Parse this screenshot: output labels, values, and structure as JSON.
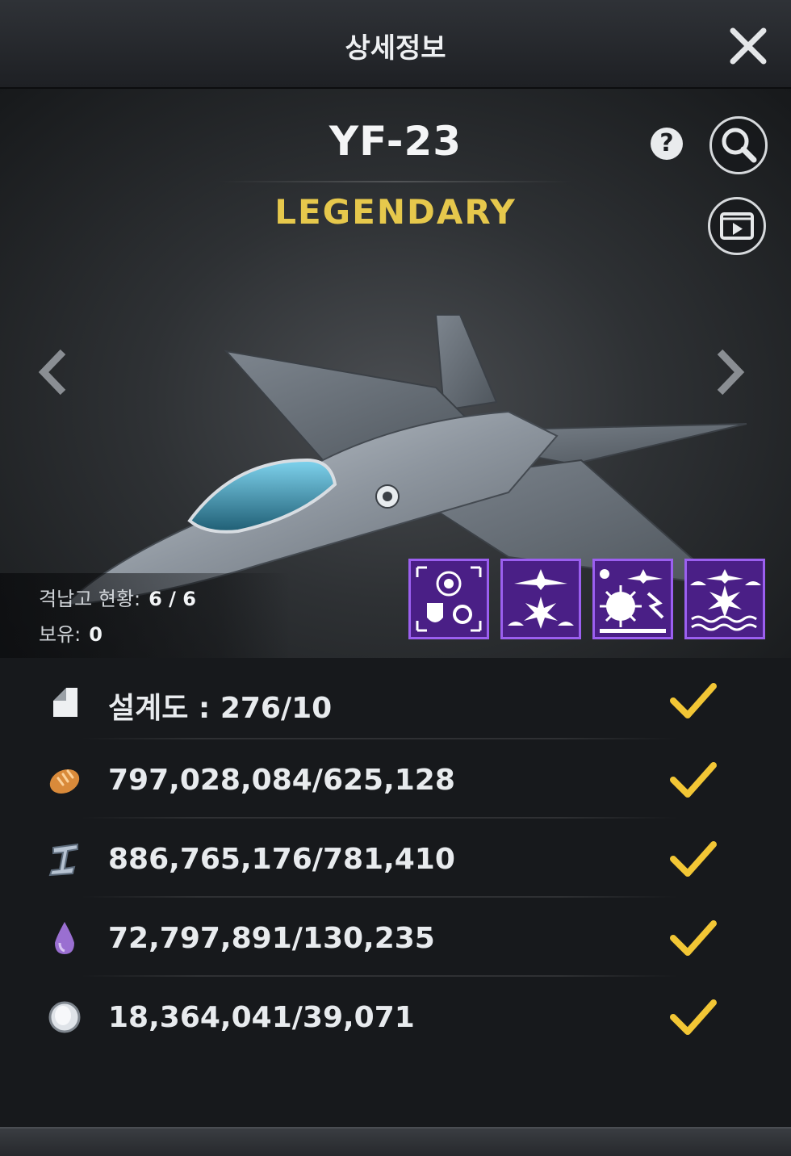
{
  "header": {
    "title": "상세정보"
  },
  "unit": {
    "name": "YF-23",
    "rarity": "LEGENDARY",
    "rarity_color": "#e6c84c",
    "status_label": "격납고 현황:",
    "status_value": "6 / 6",
    "owned_label": "보유:",
    "owned_value": "0"
  },
  "buttons": {
    "help": "?",
    "zoom_icon": "magnifier-icon",
    "video_icon": "video-play-icon",
    "close_icon": "close-icon",
    "prev_icon": "chevron-left-icon",
    "next_icon": "chevron-right-icon"
  },
  "skills": [
    {
      "icon": "radar-defense-icon"
    },
    {
      "icon": "air-strike-icon"
    },
    {
      "icon": "bombing-icon"
    },
    {
      "icon": "sea-strike-icon"
    }
  ],
  "requirements": [
    {
      "icon": "blueprint-icon",
      "text": "설계도 : 276/10",
      "met": true
    },
    {
      "icon": "bread-icon",
      "text": "797,028,084/625,128",
      "met": true
    },
    {
      "icon": "steel-icon",
      "text": "886,765,176/781,410",
      "met": true
    },
    {
      "icon": "oil-drop-icon",
      "text": "72,797,891/130,235",
      "met": true
    },
    {
      "icon": "silver-coin-icon",
      "text": "18,364,041/39,071",
      "met": true
    }
  ],
  "colors": {
    "check": "#f2c635",
    "skill_bg": "#4a1f86",
    "skill_border": "#9b5ff0"
  }
}
